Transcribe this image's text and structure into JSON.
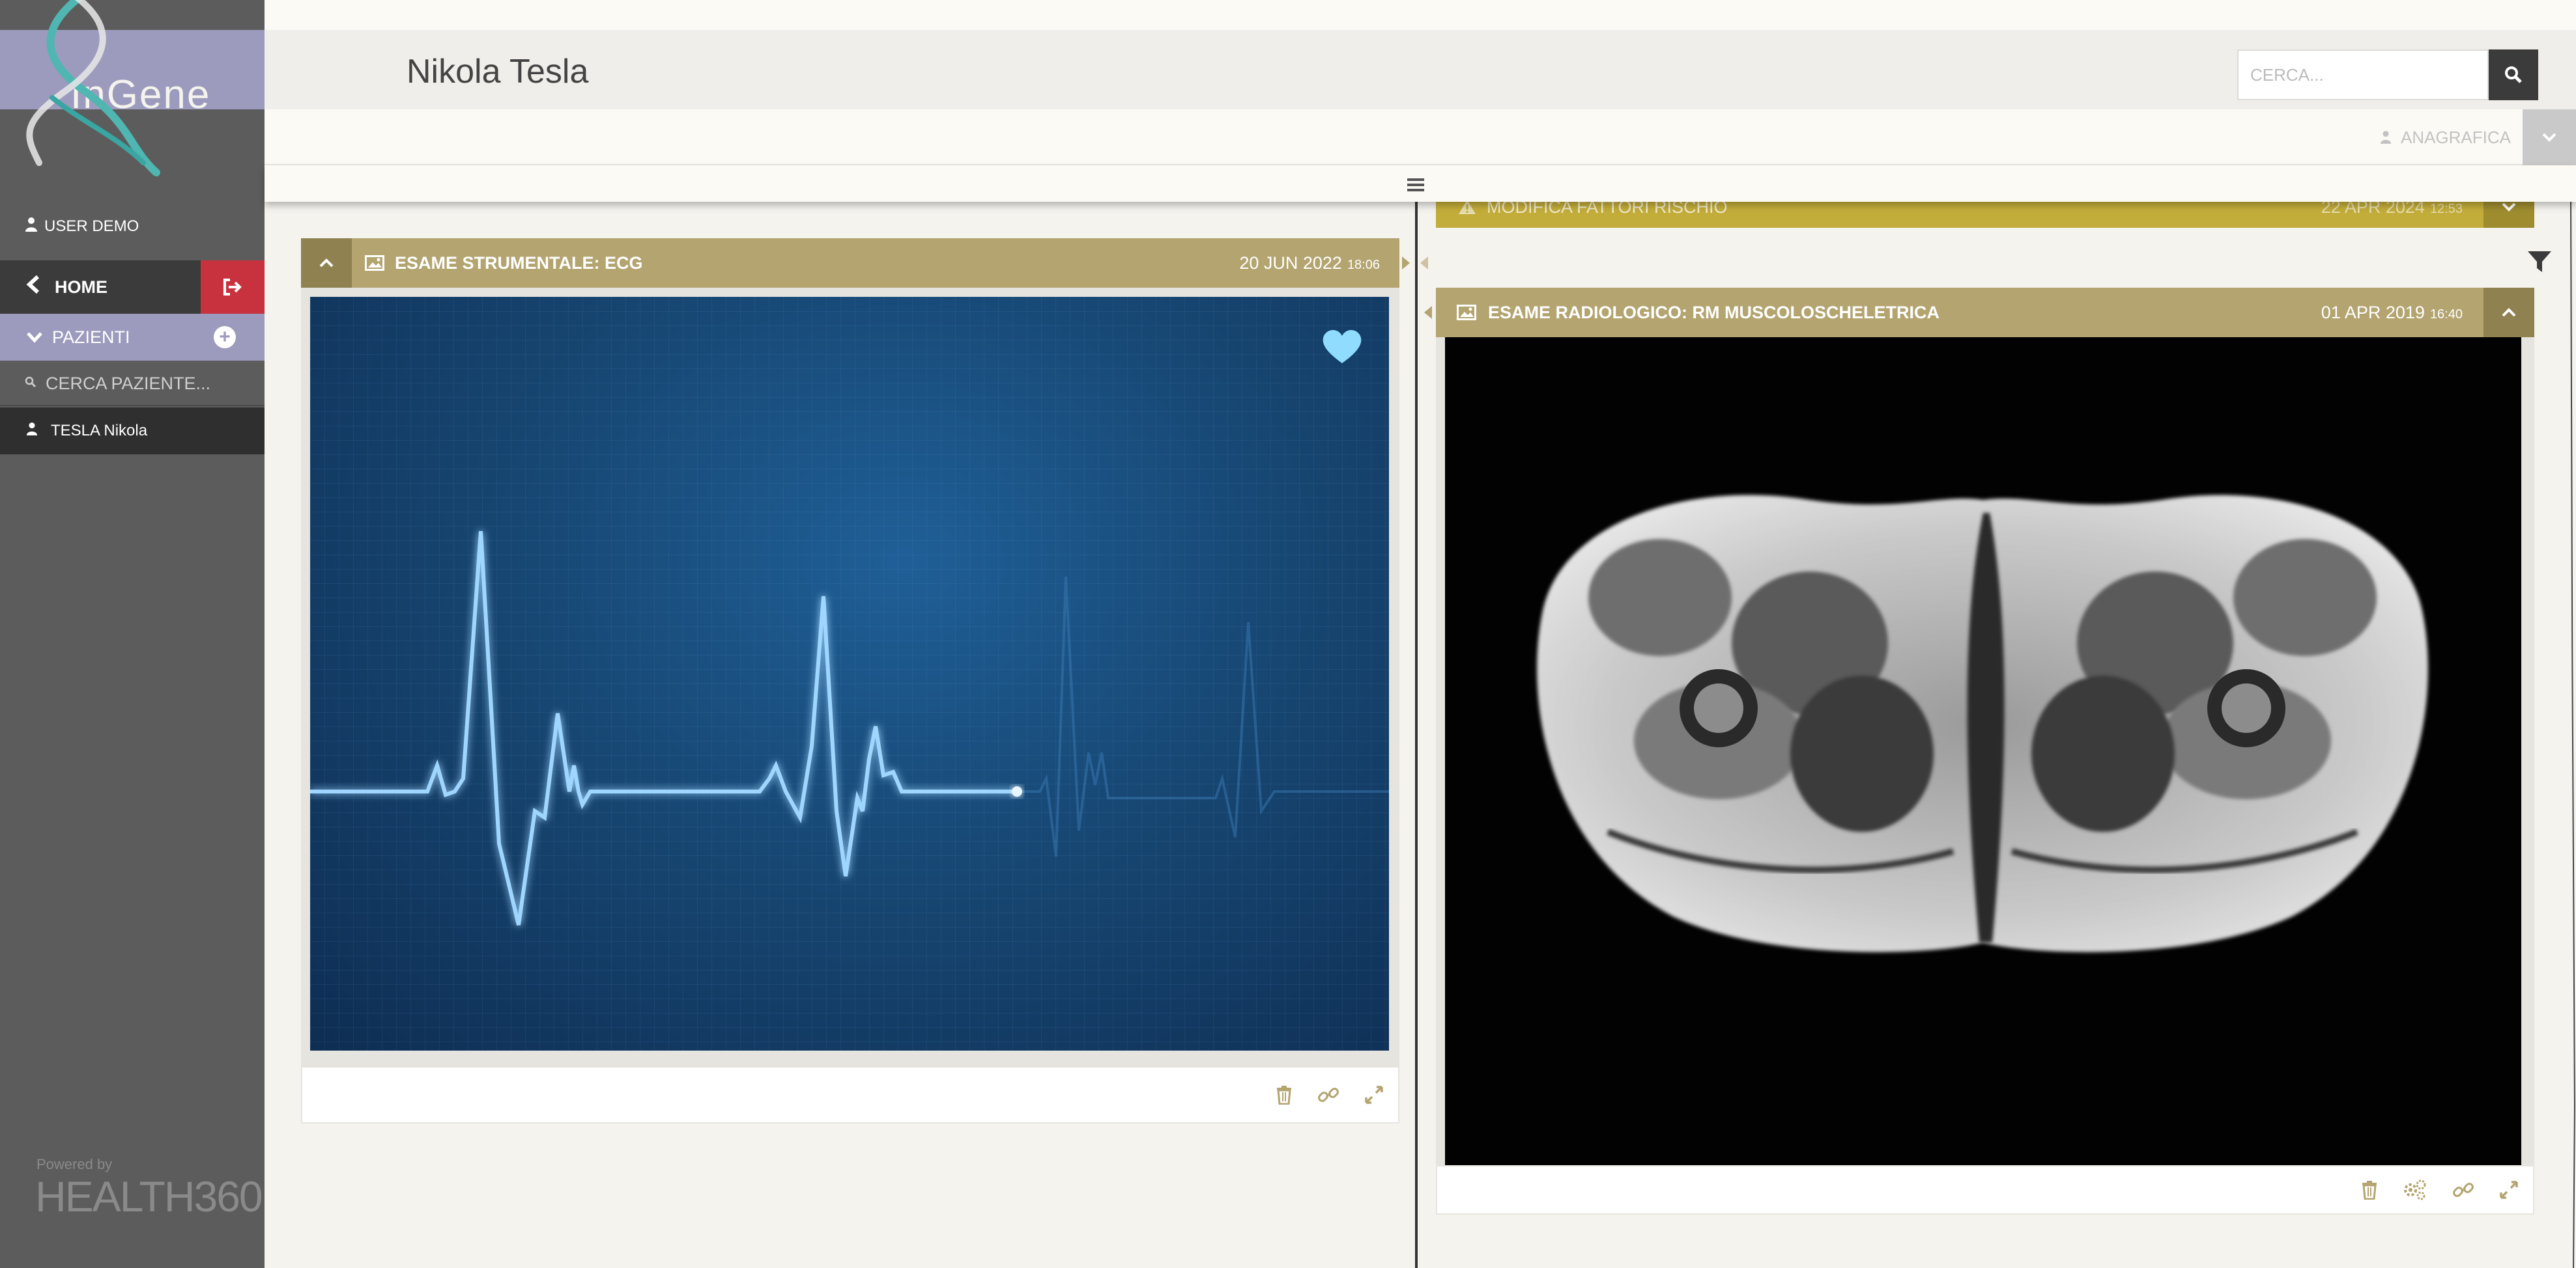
{
  "sidebar": {
    "logo_text": "InGene",
    "user_label": "USER DEMO",
    "home_label": "HOME",
    "pazienti_label": "PAZIENTI",
    "patient_search_placeholder": "CERCA PAZIENTE...",
    "patient_name": "TESLA Nikola",
    "powered_by": "Powered by",
    "brand": "HEALTH360"
  },
  "header": {
    "title": "Nikola Tesla",
    "search_placeholder": "CERCA...",
    "anagrafica_label": "ANAGRAFICA"
  },
  "cards": {
    "ecg": {
      "title": "ESAME STRUMENTALE: ECG",
      "date": "20 JUN 2022",
      "time": "18:06"
    },
    "rischio": {
      "title": "MODIFICA FATTORI RISCHIO",
      "date": "22 APR 2024",
      "time": "12:53"
    },
    "rm": {
      "title": "ESAME RADIOLOGICO: RM MUSCOLOSCHELETRICA",
      "date": "01 APR 2019",
      "time": "16:40"
    }
  },
  "colors": {
    "card_header": "#b3a470",
    "card_header_dark": "#8f8250",
    "rischio_header": "#c3ad3a",
    "sidebar_bg": "#5c5c5c",
    "logo_bg": "#9c9bbd",
    "logout_red": "#c8323e",
    "heart": "#8fdcff"
  },
  "icons": {
    "user": "user-icon",
    "home": "chevron-left-icon",
    "logout": "logout-icon",
    "pazienti": "chevron-down-icon",
    "add": "plus-circle-icon",
    "search": "search-icon",
    "image": "image-icon",
    "delete": "trash-icon",
    "link": "link-icon",
    "expand": "expand-icon",
    "share": "share-icon",
    "filter": "filter-icon",
    "favorite": "heart-icon",
    "warning": "warning-icon",
    "menu": "hamburger-icon"
  }
}
